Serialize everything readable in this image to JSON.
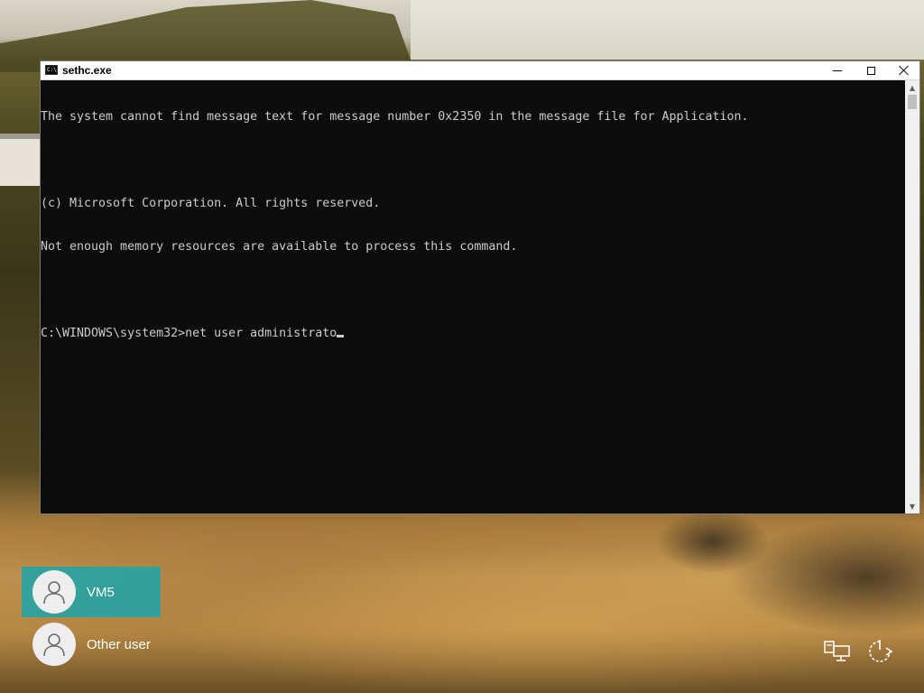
{
  "window": {
    "title": "sethc.exe",
    "icon": "console-icon",
    "icon_glyph": "C:\\"
  },
  "console": {
    "lines": [
      "The system cannot find message text for message number 0x2350 in the message file for Application.",
      "",
      "(c) Microsoft Corporation. All rights reserved.",
      "Not enough memory resources are available to process this command.",
      ""
    ],
    "prompt": "C:\\WINDOWS\\system32>",
    "input": "net user administrato"
  },
  "users": [
    {
      "name": "VM5",
      "selected": true
    },
    {
      "name": "Other user",
      "selected": false
    }
  ],
  "system_icons": [
    "network-icon",
    "power-icon"
  ],
  "colors": {
    "selected_user": "#1da4aa",
    "console_bg": "#0c0c0c",
    "console_text": "#cccccc"
  }
}
